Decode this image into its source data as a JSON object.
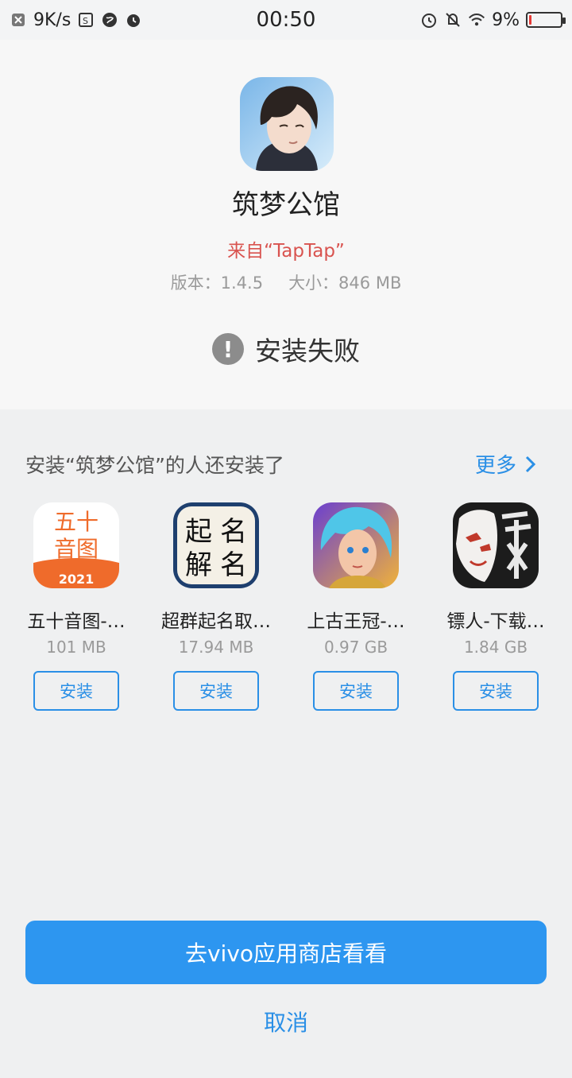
{
  "status_bar": {
    "speed": "9K/s",
    "time": "00:50",
    "battery_percent": "9%",
    "battery_level": 0.09
  },
  "app": {
    "name": "筑梦公馆",
    "source": "来自“TapTap”",
    "version": "版本：1.4.5",
    "size": "大小：846 MB",
    "status": "安装失败",
    "icon": "character-avatar-icon"
  },
  "recommendations": {
    "title": "安装“筑梦公馆”的人还安装了",
    "more_label": "更多",
    "items": [
      {
        "name": "五十音图-…",
        "size": "101 MB",
        "install_label": "安装",
        "icon": "fifty-sounds-app-icon"
      },
      {
        "name": "超群起名取…",
        "size": "17.94 MB",
        "install_label": "安装",
        "icon": "naming-app-icon"
      },
      {
        "name": "上古王冠-…",
        "size": "0.97 GB",
        "install_label": "安装",
        "icon": "ancient-crown-game-icon"
      },
      {
        "name": "镖人-下载…",
        "size": "1.84 GB",
        "install_label": "安装",
        "icon": "biaoren-game-icon"
      }
    ]
  },
  "icon_text": {
    "fifty_line1": "五十",
    "fifty_line2": "音图",
    "fifty_year": "2021",
    "naming_a": "起",
    "naming_b": "名",
    "naming_c": "解",
    "naming_d": "名"
  },
  "actions": {
    "store_button": "去vivo应用商店看看",
    "cancel": "取消"
  },
  "colors": {
    "accent": "#2d96f0",
    "source_red": "#d9534f"
  }
}
